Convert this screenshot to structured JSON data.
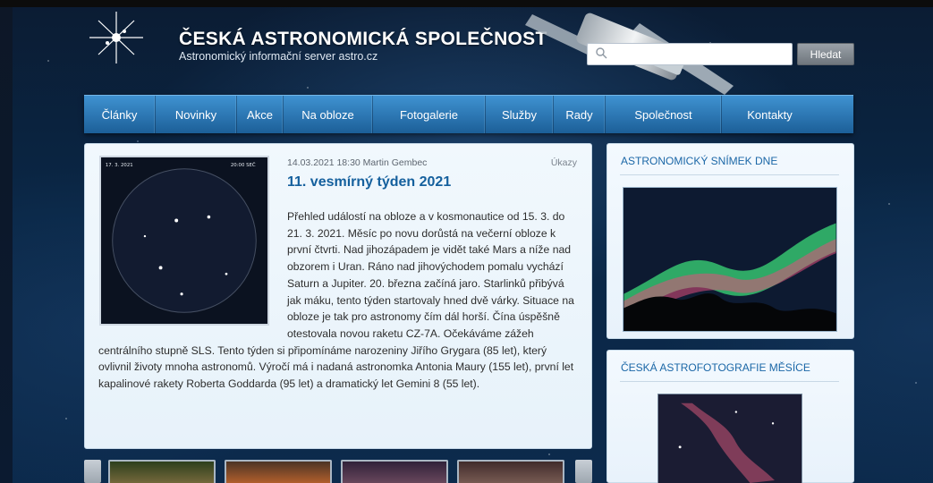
{
  "header": {
    "site_title": "ČESKÁ ASTRONOMICKÁ SPOLEČNOST",
    "site_subtitle": "Astronomický informační server astro.cz"
  },
  "search": {
    "placeholder": "",
    "button_label": "Hledat"
  },
  "nav": {
    "items": [
      {
        "label": "Články"
      },
      {
        "label": "Novinky"
      },
      {
        "label": "Akce"
      },
      {
        "label": "Na obloze"
      },
      {
        "label": "Fotogalerie"
      },
      {
        "label": "Služby"
      },
      {
        "label": "Rady"
      },
      {
        "label": "Společnost"
      },
      {
        "label": "Kontakty"
      }
    ]
  },
  "article": {
    "meta": "14.03.2021 18:30 Martin Gembec",
    "category": "Úkazy",
    "title": "11. vesmírný týden 2021",
    "image_caption_date": "17. 3. 2021",
    "image_caption_time": "20:00 SEČ",
    "body": "Přehled událostí na obloze a v kosmonautice od 15. 3. do 21. 3. 2021. Měsíc po novu dorůstá na večerní obloze k první čtvrti. Nad jihozápadem je vidět také Mars a níže nad obzorem i Uran. Ráno nad jihovýchodem pomalu vychází Saturn a Jupiter. 20. března začíná jaro. Starlinků přibývá jak máku, tento týden startovaly hned dvě várky. Situace na obloze je tak pro astronomy čím dál horší. Čína úspěšně otestovala novou raketu CZ-7A. Očekáváme zážeh centrálního stupně SLS. Tento týden si připomínáme narozeniny Jiřího Grygara (85 let), který ovlivnil životy mnoha astronomů. Výročí má i nadaná astronomka Antonia Maury (155 let), první let kapalinové rakety Roberta Goddarda (95 let) a dramatický let Gemini 8 (55 let)."
  },
  "sidebar": {
    "apod_heading": "ASTRONOMICKÝ SNÍMEK DNE",
    "moon_heading": "ČESKÁ ASTROFOTOGRAFIE MĚSÍCE"
  },
  "icons": {
    "search": "search-icon",
    "logo": "star-logo-icon"
  },
  "colors": {
    "nav_top": "#3f92d1",
    "nav_bottom": "#1c5f98",
    "title_blue": "#15609d",
    "sidebar_heading": "#1b67a7"
  }
}
